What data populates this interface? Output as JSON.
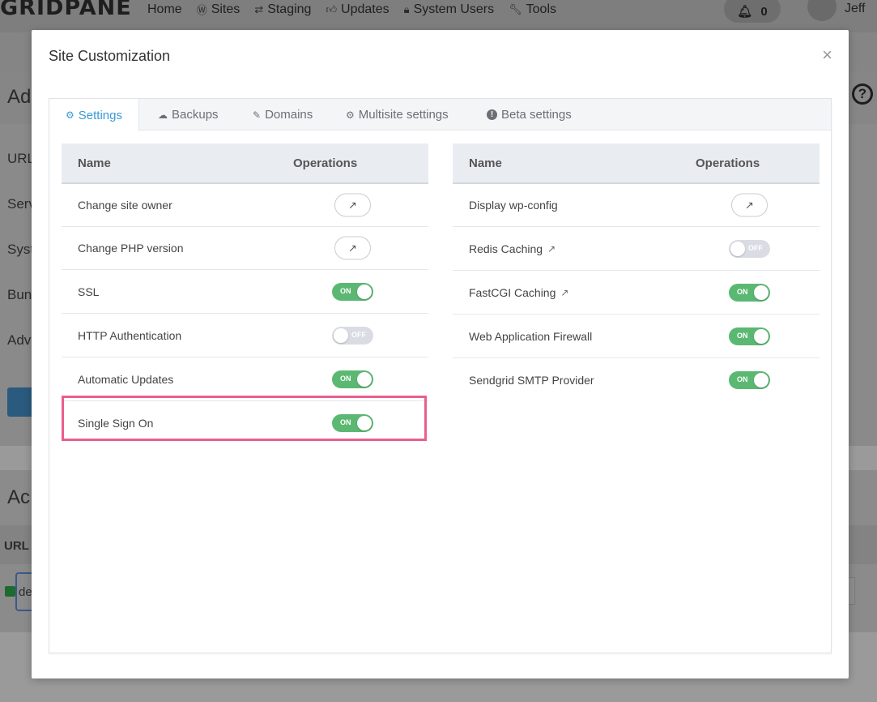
{
  "background": {
    "logo": "GRIDPANE",
    "nav": [
      {
        "icon": "home-icon",
        "label": "Home"
      },
      {
        "icon": "wordpress-icon",
        "label": "Sites"
      },
      {
        "icon": "staging-icon",
        "label": "Staging"
      },
      {
        "icon": "thumbs-up-icon",
        "label": "Updates"
      },
      {
        "icon": "lock-icon",
        "label": "System Users"
      },
      {
        "icon": "wrench-icon",
        "label": "Tools"
      }
    ],
    "notifications_count": "0",
    "user_name": "Jeff",
    "card_title_partial": "Ad",
    "labels_partial": [
      "URL",
      "Serv",
      "Syst",
      "Bun",
      "Adv"
    ],
    "second_card_title_partial": "Ac",
    "table_header_partial": "URL",
    "row_text_partial": "de"
  },
  "modal": {
    "title": "Site Customization",
    "close_label": "×",
    "tabs": [
      {
        "icon": "gear-icon",
        "label": "Settings",
        "active": true
      },
      {
        "icon": "cloud-upload-icon",
        "label": "Backups",
        "active": false
      },
      {
        "icon": "edit-icon",
        "label": "Domains",
        "active": false
      },
      {
        "icon": "gear-icon",
        "label": "Multisite settings",
        "active": false
      },
      {
        "icon": "exclamation-circle-icon",
        "label": "Beta settings",
        "active": false
      }
    ],
    "left_table": {
      "headers": {
        "name": "Name",
        "operations": "Operations"
      },
      "rows": [
        {
          "name": "Change site owner",
          "op": "link"
        },
        {
          "name": "Change PHP version",
          "op": "link"
        },
        {
          "name": "SSL",
          "op": "toggle",
          "state": "ON"
        },
        {
          "name": "HTTP Authentication",
          "op": "toggle",
          "state": "OFF"
        },
        {
          "name": "Automatic Updates",
          "op": "toggle",
          "state": "ON"
        },
        {
          "name": "Single Sign On",
          "op": "toggle",
          "state": "ON"
        }
      ]
    },
    "right_table": {
      "headers": {
        "name": "Name",
        "operations": "Operations"
      },
      "rows": [
        {
          "name": "Display wp-config",
          "op": "link",
          "external": false
        },
        {
          "name": "Redis Caching",
          "op": "toggle",
          "state": "OFF",
          "external": true
        },
        {
          "name": "FastCGI Caching",
          "op": "toggle",
          "state": "ON",
          "external": true
        },
        {
          "name": "Web Application Firewall",
          "op": "toggle",
          "state": "ON",
          "external": false
        },
        {
          "name": "Sendgrid SMTP Provider",
          "op": "toggle",
          "state": "ON",
          "external": false
        }
      ]
    },
    "highlighted_row": "Single Sign On"
  },
  "colors": {
    "accent": "#3b98d6",
    "toggle_on": "#5bb872",
    "toggle_off": "#d9dde3",
    "highlight": "#ea5e8e"
  }
}
